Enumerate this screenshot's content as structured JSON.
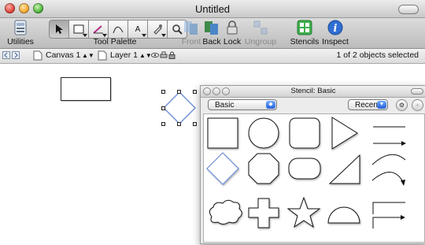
{
  "window": {
    "title": "Untitled"
  },
  "toolbar": {
    "utilities_label": "Utilities",
    "tool_palette_label": "Tool Palette",
    "palette_tool_text": "A",
    "front_label": "Front",
    "back_label": "Back",
    "lock_label": "Lock",
    "ungroup_label": "Ungroup",
    "stencils_label": "Stencils",
    "inspect_label": "Inspect"
  },
  "statusbar": {
    "canvas_name": "Canvas 1",
    "layer_name": "Layer 1",
    "selection_status": "1 of 2 objects selected"
  },
  "stencil": {
    "title": "Stencil: Basic",
    "library": "Basic",
    "filter": "Recent",
    "shapes": [
      "rectangle",
      "circle",
      "rounded-rectangle",
      "triangle-right",
      "line",
      "arrow-line",
      "diamond",
      "octagon",
      "capsule",
      "right-triangle",
      "curved-line",
      "curved-arrow",
      "cloud",
      "cross",
      "star",
      "half-circle",
      "elbow-line",
      "elbow-arrow"
    ]
  },
  "colors": {
    "selection_blue": "#6c8ed6",
    "stencils_green": "#3fae4e",
    "inspect_blue": "#2f6fd2"
  }
}
